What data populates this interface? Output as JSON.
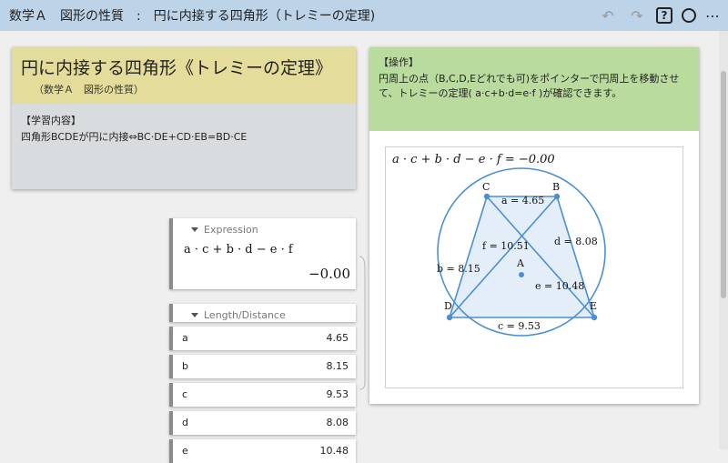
{
  "topbar": {
    "title": "数学Ａ　図形の性質　:　円に内接する四角形（トレミーの定理)",
    "icons": [
      "undo-icon",
      "redo-icon",
      "help-icon",
      "circle-icon",
      "more-icon"
    ],
    "help_glyph": "?",
    "more_glyph": "⋯",
    "undo_glyph": "↶",
    "redo_glyph": "↷"
  },
  "left_card": {
    "title": "円に内接する四角形《トレミーの定理》",
    "subtitle": "（数学Ａ　図形の性質）",
    "label": "【学習内容】",
    "text": "四角形BCDEが円に内接⇔BC·DE+CD·EB=BD·CE"
  },
  "right_card": {
    "label": "【操作】",
    "text": "円周上の点（B,C,D,Eどれでも可)をポインターで円周上を移動させて、トレミーの定理( a·c+b·d=e·f )が確認できます。",
    "graph_expression": "a · c + b · d − e · f = −0.00"
  },
  "graph": {
    "points": [
      "A",
      "B",
      "C",
      "D",
      "E"
    ],
    "segments": {
      "a": "a = 4.65",
      "b": "b = 8.15",
      "c": "c = 9.53",
      "d": "d = 8.08",
      "e": "e = 10.48",
      "f": "f = 10.51"
    }
  },
  "expression_panel": {
    "header": "Expression",
    "formula": "a · c + b · d − e · f",
    "value": "−0.00"
  },
  "length_panel": {
    "header": "Length/Distance",
    "rows": [
      {
        "name": "a",
        "value": "4.65"
      },
      {
        "name": "b",
        "value": "8.15"
      },
      {
        "name": "c",
        "value": "9.53"
      },
      {
        "name": "d",
        "value": "8.08"
      },
      {
        "name": "e",
        "value": "10.48"
      }
    ]
  },
  "colors": {
    "topbar": "#bcd3e8",
    "title_header": "#e4dc9b",
    "operation_header": "#b9dc9e",
    "geometry_blue": "#4a8fd6",
    "fill_blue": "#e3eef9"
  }
}
